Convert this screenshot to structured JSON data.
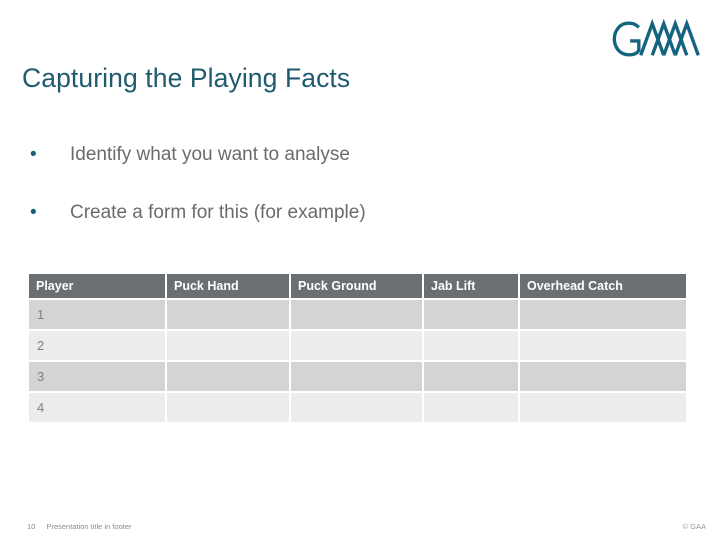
{
  "slide": {
    "title": "Capturing the Playing Facts",
    "title_color": "#1f5a6e",
    "background_color": "#ffffff"
  },
  "logo": {
    "name": "gaa-logo",
    "alt_text": "GAA",
    "color": "#14637f"
  },
  "bullets": {
    "marker": "•",
    "marker_color": "#17607a",
    "text_color": "#6b6b6b",
    "items": [
      {
        "text": "Identify what you want to analyse"
      },
      {
        "text": "Create a form for this (for example)"
      }
    ]
  },
  "table": {
    "header_background": "#6b6f72",
    "header_text_color": "#ffffff",
    "row_odd_background": "#d2d4d5",
    "row_even_background": "#ebecec",
    "cell_text_color": "#808080",
    "columns": [
      "Player",
      "Puck Hand",
      "Puck Ground",
      "Jab Lift",
      "Overhead Catch"
    ],
    "rows": [
      {
        "cells": [
          "1",
          "",
          "",
          "",
          ""
        ]
      },
      {
        "cells": [
          "2",
          "",
          "",
          "",
          ""
        ]
      },
      {
        "cells": [
          "3",
          "",
          "",
          "",
          ""
        ]
      },
      {
        "cells": [
          "4",
          "",
          "",
          "",
          ""
        ]
      }
    ]
  },
  "footer": {
    "page_number": "10",
    "title_text": "Presentation title in footer",
    "copyright": "© GAA"
  }
}
